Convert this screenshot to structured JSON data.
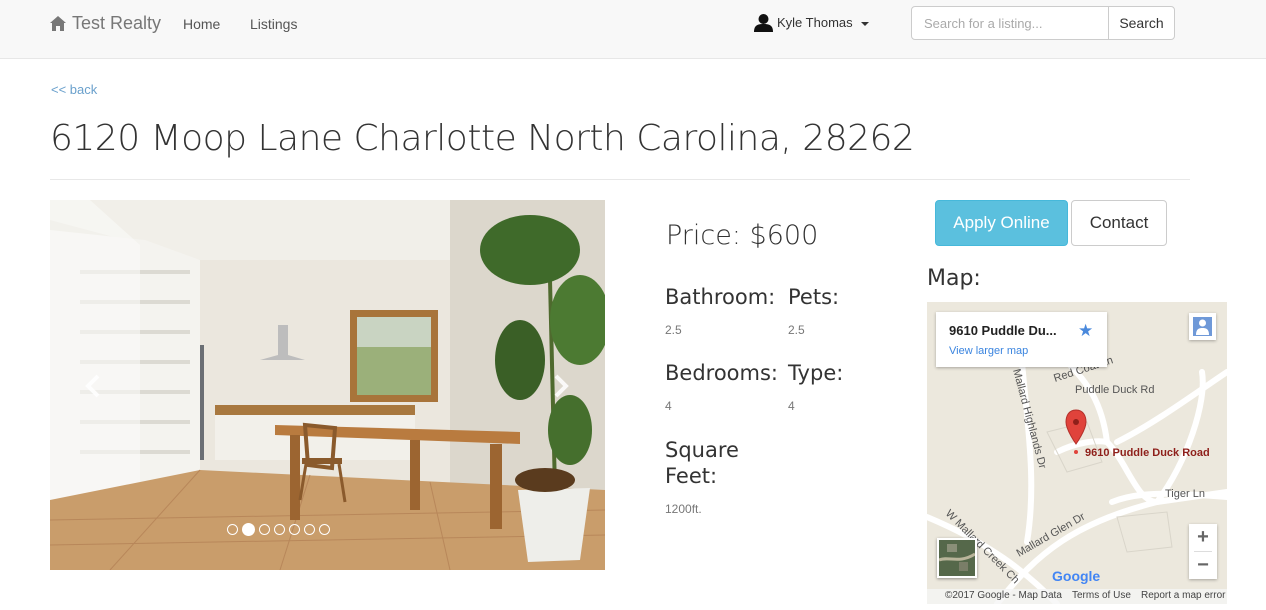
{
  "navbar": {
    "brand": "Test Realty",
    "links": [
      "Home",
      "Listings"
    ],
    "user": "Kyle Thomas",
    "search_placeholder": "Search for a listing...",
    "search_button": "Search"
  },
  "back_link": "<< back",
  "title": "6120 Moop Lane Charlotte North Carolina, 28262",
  "carousel": {
    "indicator_count": 7,
    "active_index": 1
  },
  "details": {
    "price": "Price: $600",
    "bathroom_label": "Bathroom:",
    "bathroom_value": "2.5",
    "pets_label": "Pets:",
    "pets_value": "2.5",
    "bedrooms_label": "Bedrooms:",
    "bedrooms_value": "4",
    "type_label": "Type:",
    "type_value": "4",
    "sqft_label_line1": "Square",
    "sqft_label_line2": "Feet:",
    "sqft_value": "1200ft."
  },
  "actions": {
    "apply": "Apply Online",
    "contact": "Contact"
  },
  "map": {
    "label": "Map:",
    "card_title": "9610 Puddle Du...",
    "card_link": "View larger map",
    "marker_label": "9610 Puddle Duck Road",
    "streets": [
      "Red Coat Ln",
      "Puddle Duck Rd",
      "Mallard Highlands Dr",
      "Tiger Ln",
      "W Mallard Creek Ch",
      "Mallard Glen Dr"
    ],
    "zoom_in": "+",
    "zoom_out": "−",
    "logo": "Google",
    "attribution": "©2017 Google - Map Data",
    "terms": "Terms of Use",
    "report": "Report a map error"
  },
  "colors": {
    "accent": "#5bc0de",
    "link": "#6aa0cc",
    "marker": "#e0433b"
  }
}
